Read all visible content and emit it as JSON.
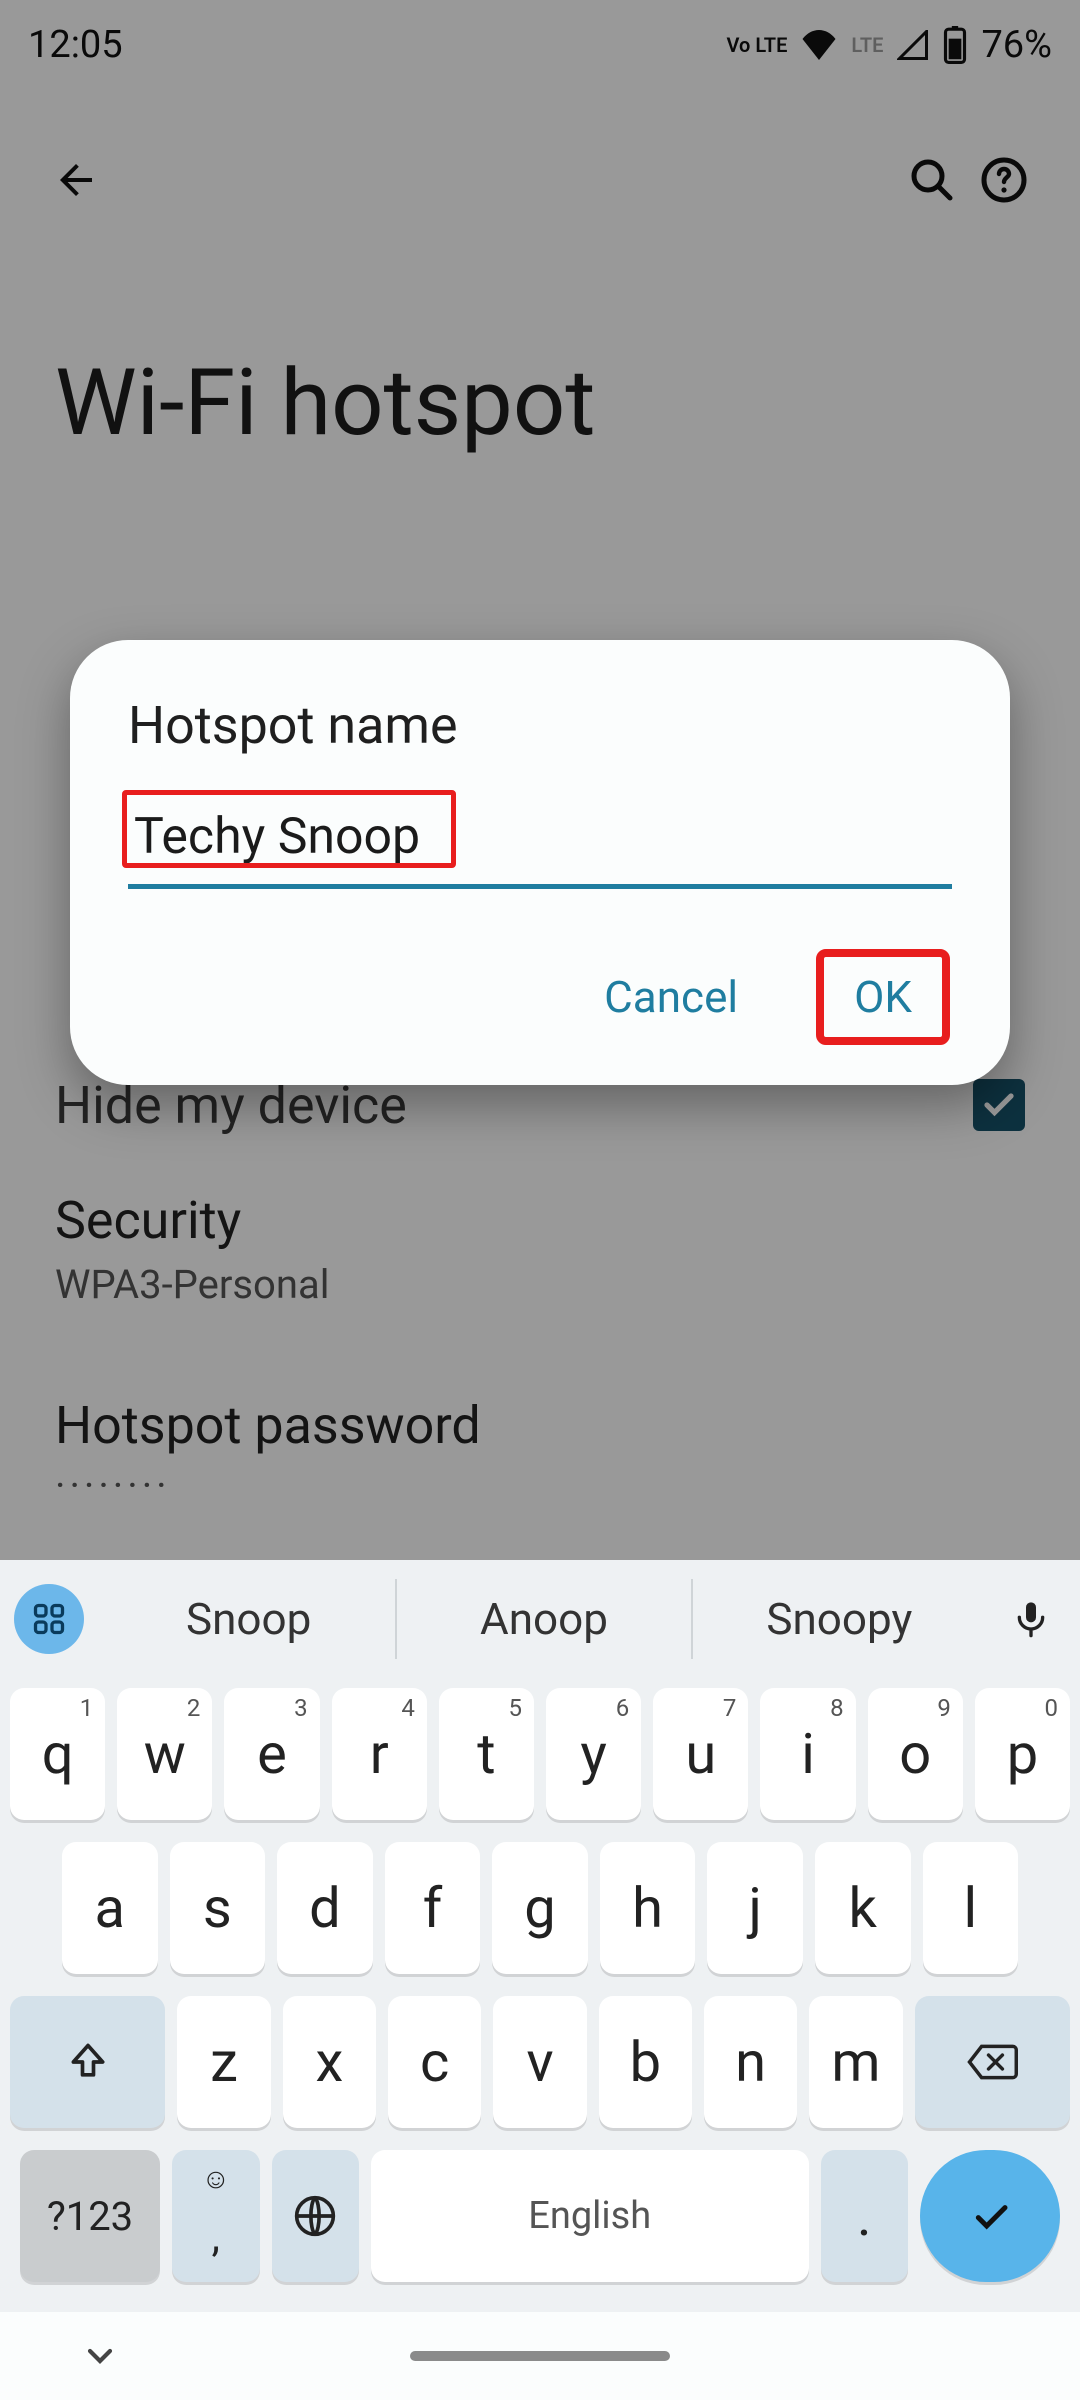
{
  "statusbar": {
    "time": "12:05",
    "volte": "Vo LTE",
    "lte": "LTE",
    "battery_pct": "76%"
  },
  "appbar": {
    "back_icon": "arrow-back",
    "search_icon": "search",
    "help_icon": "help-circle"
  },
  "page": {
    "title": "Wi-Fi hotspot"
  },
  "dialog": {
    "title": "Hotspot name",
    "input_value": "Techy Snoop",
    "cancel": "Cancel",
    "ok": "OK"
  },
  "settings": {
    "hide_device": {
      "label": "Hide my device",
      "checked": true
    },
    "security": {
      "label": "Security",
      "value": "WPA3-Personal"
    },
    "password": {
      "label": "Hotspot password",
      "value_masked": "········"
    }
  },
  "keyboard": {
    "suggestions": [
      "Snoop",
      "Anoop",
      "Snoopy"
    ],
    "row1": [
      {
        "k": "q",
        "n": "1"
      },
      {
        "k": "w",
        "n": "2"
      },
      {
        "k": "e",
        "n": "3"
      },
      {
        "k": "r",
        "n": "4"
      },
      {
        "k": "t",
        "n": "5"
      },
      {
        "k": "y",
        "n": "6"
      },
      {
        "k": "u",
        "n": "7"
      },
      {
        "k": "i",
        "n": "8"
      },
      {
        "k": "o",
        "n": "9"
      },
      {
        "k": "p",
        "n": "0"
      }
    ],
    "row2": [
      "a",
      "s",
      "d",
      "f",
      "g",
      "h",
      "j",
      "k",
      "l"
    ],
    "row3": [
      "z",
      "x",
      "c",
      "v",
      "b",
      "n",
      "m"
    ],
    "sym": "?123",
    "comma": ",",
    "space": "English",
    "period": "."
  }
}
